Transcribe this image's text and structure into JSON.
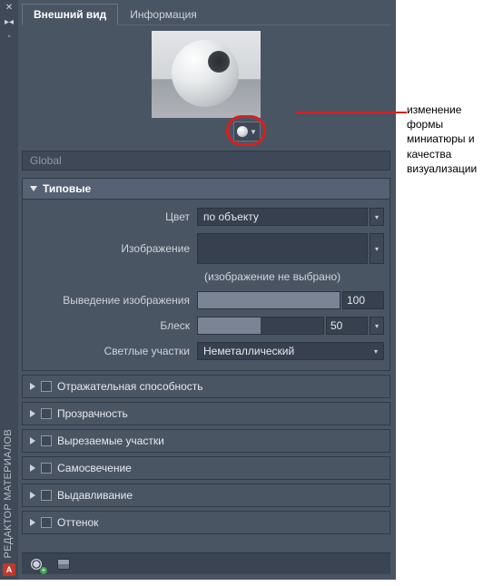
{
  "sidebar": {
    "title": "РЕДАКТОР МАТЕРИАЛОВ",
    "badge": "A"
  },
  "tabs": {
    "appearance": "Внешний вид",
    "info": "Информация"
  },
  "material_name": "Global",
  "callout": "изменение формы миниатюры и качества визуализации",
  "section_generic": {
    "title": "Типовые",
    "color_label": "Цвет",
    "color_value": "по объекту",
    "image_label": "Изображение",
    "image_empty": "(изображение не выбрано)",
    "fade_label": "Выведение изображения",
    "fade_value": "100",
    "gloss_label": "Блеск",
    "gloss_value": "50",
    "highlights_label": "Светлые участки",
    "highlights_value": "Неметаллический"
  },
  "sections_collapsed": [
    "Отражательная способность",
    "Прозрачность",
    "Вырезаемые участки",
    "Самосвечение",
    "Выдавливание",
    "Оттенок"
  ]
}
